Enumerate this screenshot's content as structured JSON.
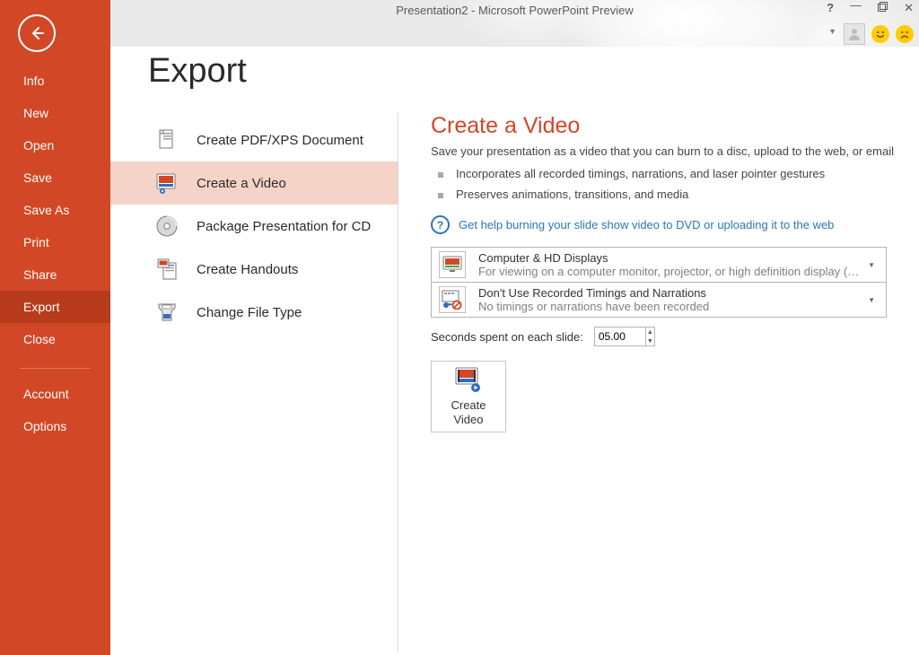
{
  "window": {
    "title": "Presentation2 - Microsoft PowerPoint Preview"
  },
  "sidebar": {
    "items": [
      {
        "label": "Info"
      },
      {
        "label": "New"
      },
      {
        "label": "Open"
      },
      {
        "label": "Save"
      },
      {
        "label": "Save As"
      },
      {
        "label": "Print"
      },
      {
        "label": "Share"
      },
      {
        "label": "Export"
      },
      {
        "label": "Close"
      }
    ],
    "bottom_items": [
      {
        "label": "Account"
      },
      {
        "label": "Options"
      }
    ]
  },
  "page": {
    "title": "Export"
  },
  "export_types": [
    {
      "label": "Create PDF/XPS Document",
      "icon": "pdf"
    },
    {
      "label": "Create a Video",
      "icon": "video"
    },
    {
      "label": "Package Presentation for CD",
      "icon": "cd"
    },
    {
      "label": "Create Handouts",
      "icon": "handouts"
    },
    {
      "label": "Change File Type",
      "icon": "filetype"
    }
  ],
  "detail": {
    "title": "Create a Video",
    "description": "Save your presentation as a video that you can burn to a disc, upload to the web, or email",
    "bullets": [
      "Incorporates all recorded timings, narrations, and laser pointer gestures",
      "Preserves animations, transitions, and media"
    ],
    "help_link": "Get help burning your slide show video to DVD or uploading it to the web",
    "quality": {
      "title": "Computer & HD Displays",
      "subtitle": "For viewing on a computer monitor, projector, or high definition display  (Lar..."
    },
    "timings": {
      "title": "Don't Use Recorded Timings and Narrations",
      "subtitle": "No timings or narrations have been recorded"
    },
    "seconds_label": "Seconds spent on each slide:",
    "seconds_value": "05.00",
    "create_button": "Create\nVideo"
  }
}
